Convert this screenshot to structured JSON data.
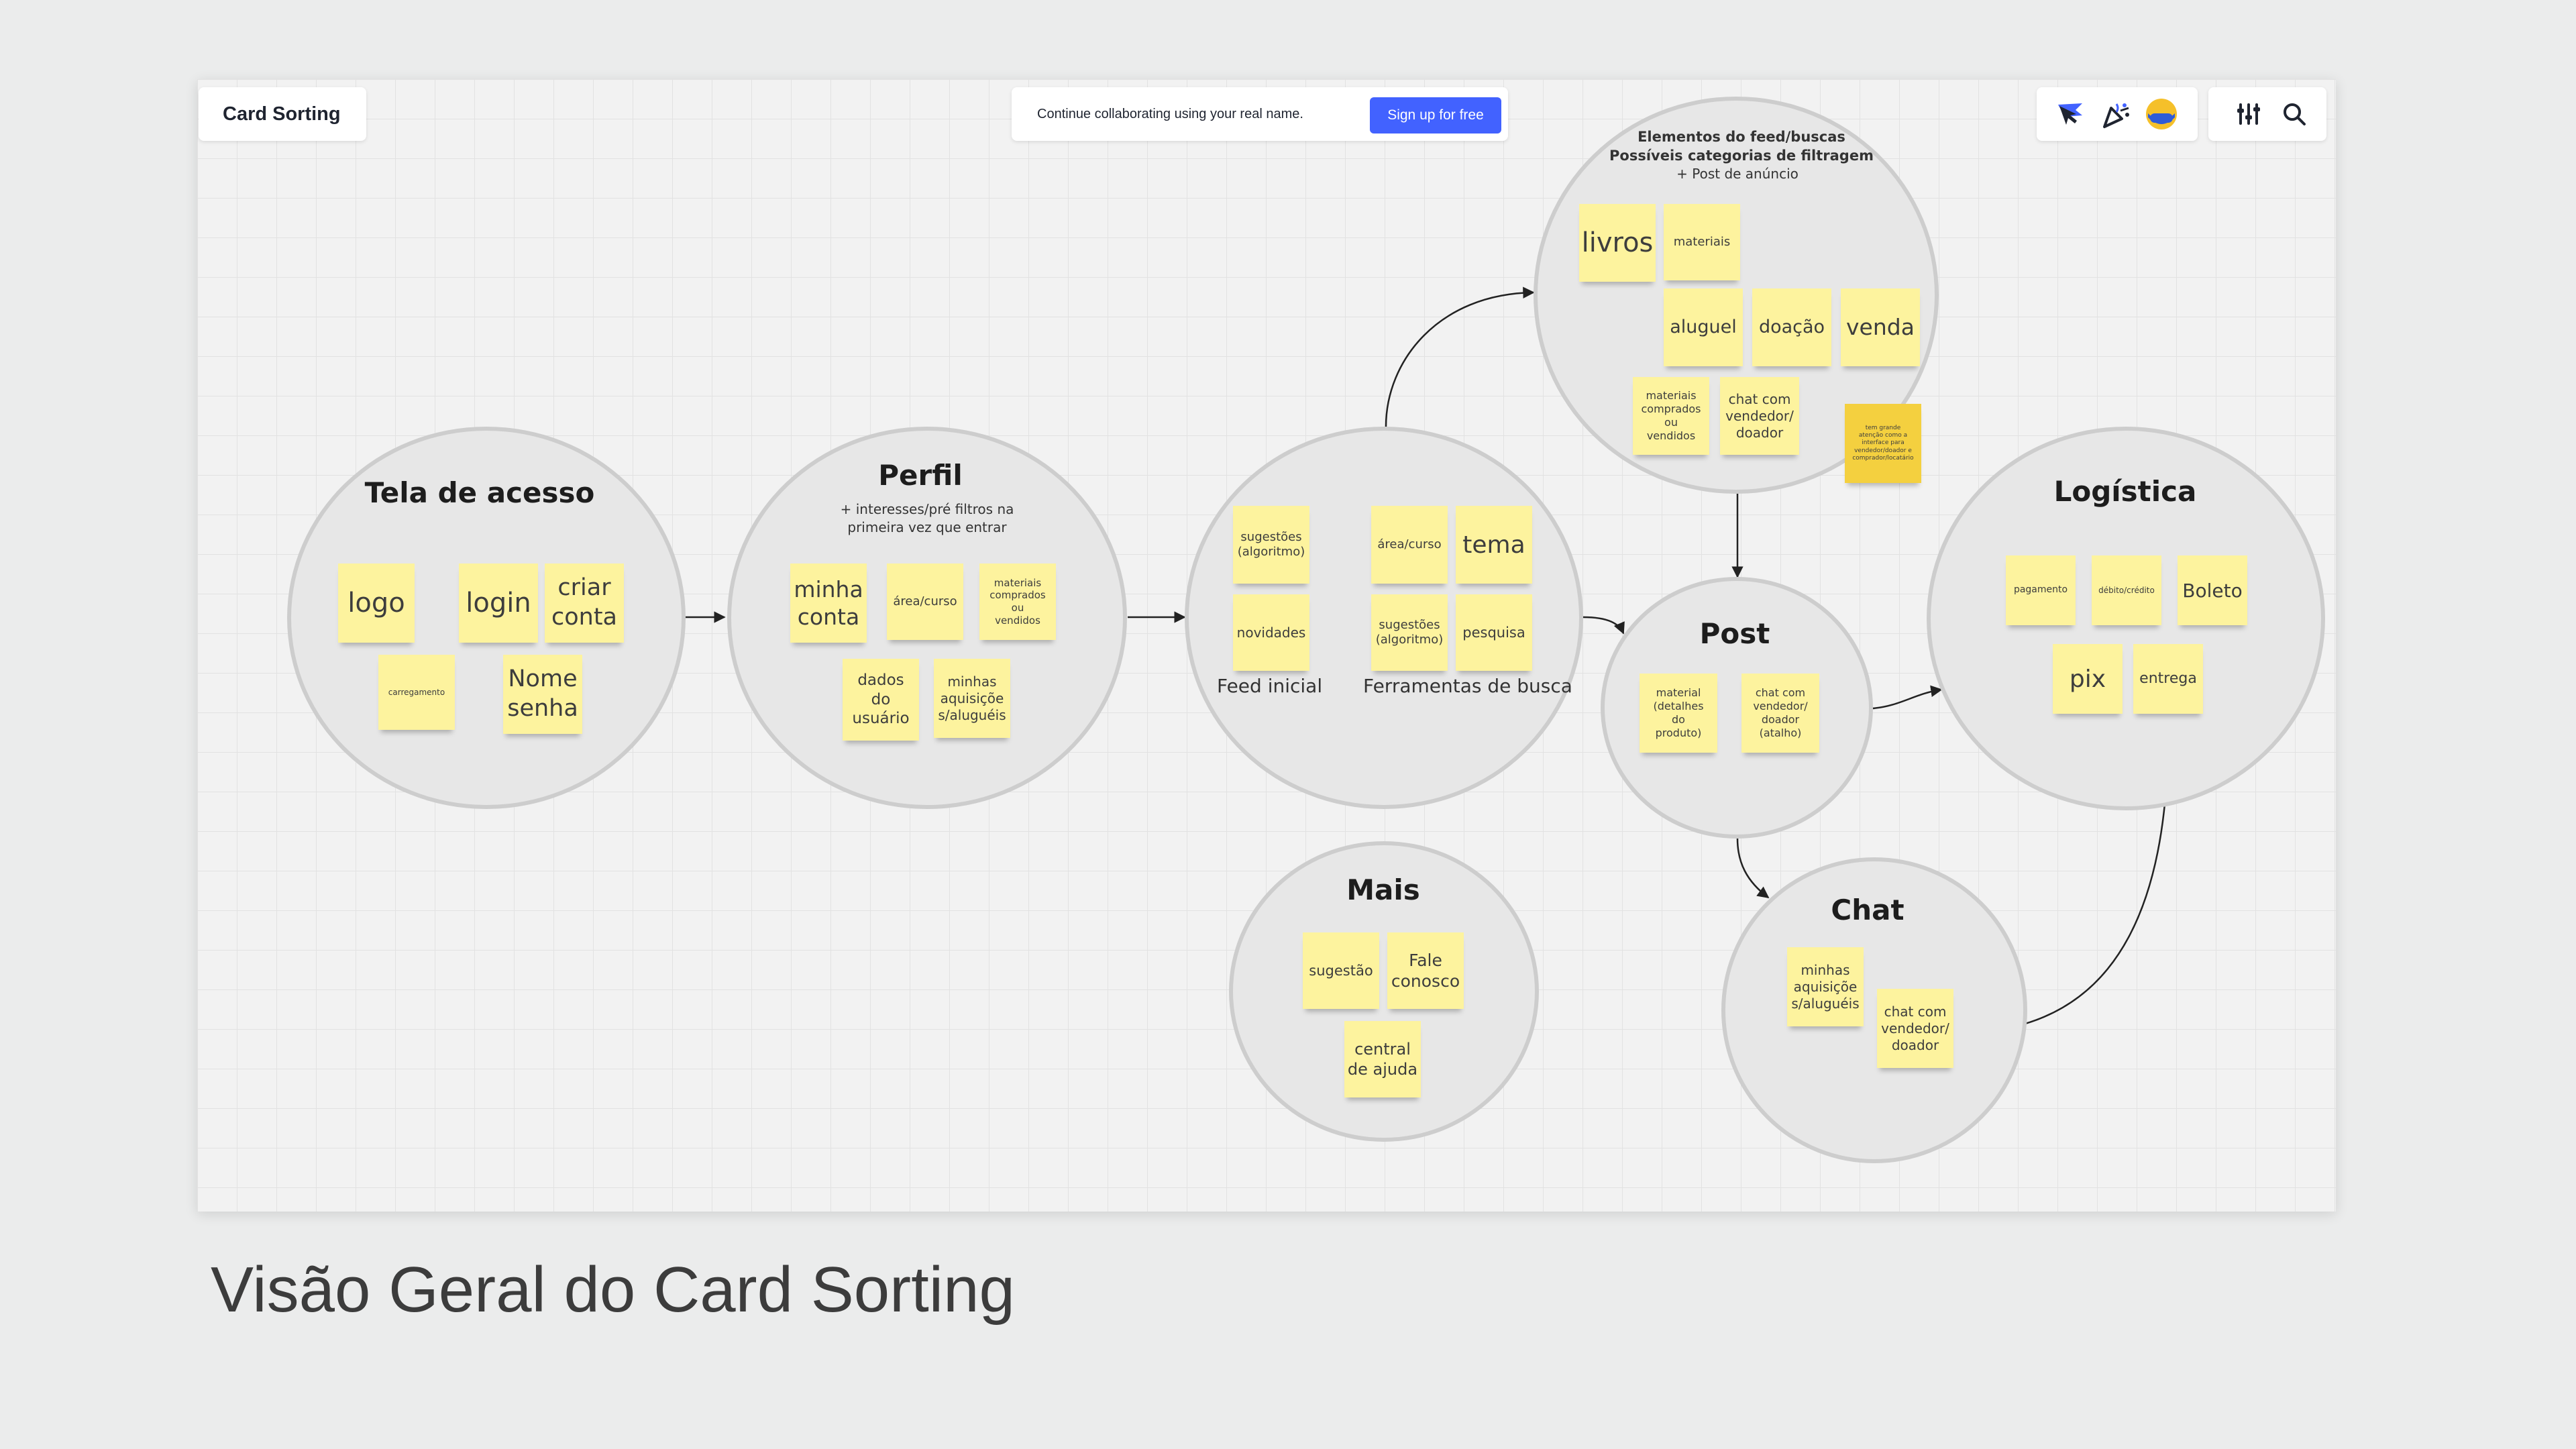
{
  "board_title": "Card Sorting",
  "collab_banner": {
    "text": "Continue collaborating using your real name.",
    "button": "Sign up for free"
  },
  "toolbar": {
    "icons": [
      "cursor-flag-icon",
      "celebrate-icon",
      "user-avatar-icon",
      "settings-sliders-icon",
      "search-icon"
    ]
  },
  "groups": {
    "tela": {
      "title": "Tela de acesso",
      "notes": [
        "logo",
        "login",
        "criar\nconta",
        "carregamento",
        "Nome\nsenha"
      ]
    },
    "perfil": {
      "title": "Perfil",
      "subtitle": "+ interesses/pré filtros na\nprimeira vez que entrar",
      "notes": [
        "minha\nconta",
        "área/curso",
        "materiais\ncomprados\nou\nvendidos",
        "dados\ndo\nusuário",
        "minhas\naquisiçõe\ns/aluguéis"
      ]
    },
    "feed": {
      "notes": [
        "sugestões\n(algoritmo)",
        "novidades",
        "área/curso",
        "tema",
        "sugestões\n(algoritmo)",
        "pesquisa"
      ],
      "label_feed": "Feed inicial",
      "label_busca": "Ferramentas de busca"
    },
    "elementos": {
      "title": "Elementos do feed/buscas\nPossíveis categorias de filtragem",
      "subtitle": "+ Post de anúncio",
      "notes": [
        "livros",
        "materiais",
        "aluguel",
        "doação",
        "venda",
        "materiais\ncomprados\nou\nvendidos",
        "chat com\nvendedor/\ndoador"
      ],
      "side_note": "tem grande\natenção como a\ninterface para\nvendedor/doador e\ncomprador/locatário"
    },
    "post": {
      "title": "Post",
      "notes": [
        "material\n(detalhes\ndo\nproduto)",
        "chat com\nvendedor/\ndoador\n(atalho)"
      ]
    },
    "logistica": {
      "title": "Logística",
      "notes": [
        "pagamento",
        "débito/crédito",
        "Boleto",
        "pix",
        "entrega"
      ]
    },
    "mais": {
      "title": "Mais",
      "notes": [
        "sugestão",
        "Fale\nconosco",
        "central\nde ajuda"
      ]
    },
    "chat": {
      "title": "Chat",
      "notes": [
        "minhas\naquisiçõe\ns/aluguéis",
        "chat com\nvendedor/\ndoador"
      ]
    }
  },
  "caption": "Visão Geral do Card Sorting",
  "colors": {
    "sticky": "#fdf39e",
    "sticky_dark": "#f4d03f",
    "accent": "#4262ff",
    "circle_fill": "#e7e7e7",
    "circle_border": "#cdcdcd"
  }
}
